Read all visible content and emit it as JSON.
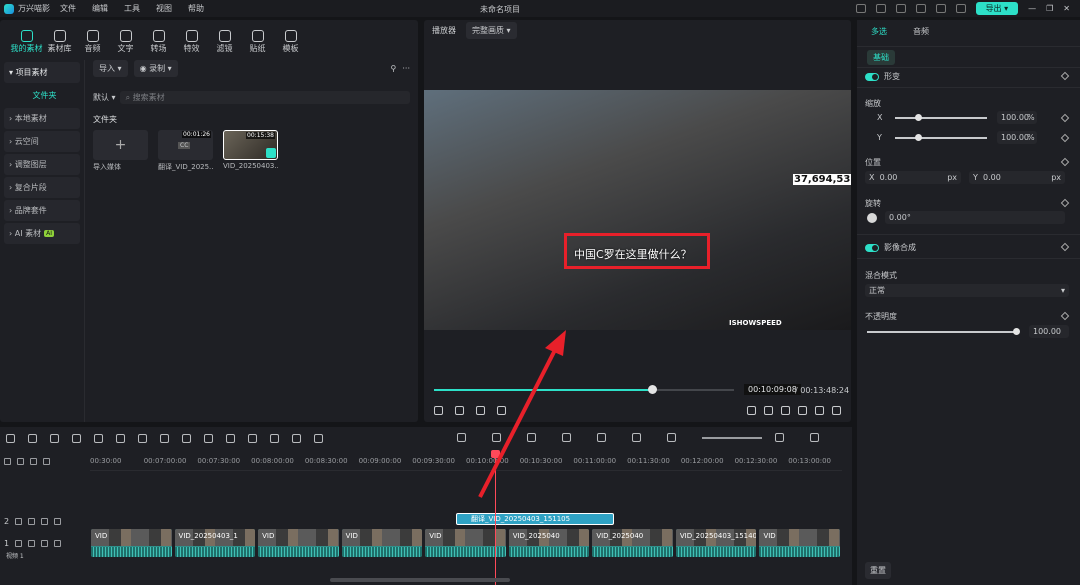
{
  "app": {
    "name": "万兴喵影",
    "project_title": "未命名项目",
    "export_label": "导出"
  },
  "menu": [
    "文件",
    "编辑",
    "工具",
    "视图",
    "帮助"
  ],
  "tools": [
    "我的素材",
    "素材库",
    "音频",
    "文字",
    "转场",
    "特效",
    "滤镜",
    "贴纸",
    "模板"
  ],
  "sidebar": {
    "header": "项目素材",
    "selected": "文件夹",
    "items": [
      "本地素材",
      "云空间",
      "调整图层",
      "复合片段",
      "品牌套件",
      "AI 素材"
    ],
    "ai_badge": "AI"
  },
  "library": {
    "import_label": "导入",
    "record_label": "录制",
    "sort_label": "默认",
    "search_placeholder": "搜索素材",
    "folder_title": "文件夹",
    "items": [
      {
        "label": "导入媒体",
        "duration": ""
      },
      {
        "label": "翻译_VID_2025...",
        "duration": "00:01:26",
        "badge": "CC"
      },
      {
        "label": "VID_20250403...",
        "duration": "00:15:38"
      }
    ]
  },
  "player": {
    "label": "播放器",
    "quality": "完整画质",
    "subtitle": "中国C罗在这里做什么？",
    "counter": "37,694,53",
    "watermark": "ISHOWSPEED",
    "time_current": "00:10:09:08",
    "time_separator": "/",
    "time_total": "00:13:48:24",
    "progress": 0.73
  },
  "properties": {
    "tabs": [
      "多选",
      "音频"
    ],
    "basic_label": "基础",
    "sections": {
      "image": "形变",
      "scale": "缩放",
      "position": "位置",
      "rotate": "旋转",
      "compositing": "影像合成",
      "blend": "混合模式",
      "opacity": "不透明度"
    },
    "scale_x": "100.00",
    "scale_y": "100.00",
    "unit_percent": "%",
    "pos_x": "0.00",
    "pos_y": "0.00",
    "unit_px": "px",
    "axis_x": "X",
    "axis_y": "Y",
    "rotation": "0.00°",
    "blend_mode": "正常",
    "opacity": "100.00",
    "reset_label": "重置"
  },
  "timeline": {
    "ruler": [
      "00:30:00",
      "00:07:00:00",
      "00:07:30:00",
      "00:08:00:00",
      "00:08:30:00",
      "00:09:00:00",
      "00:09:30:00",
      "00:10:00:00",
      "00:10:30:00",
      "00:11:00:00",
      "00:11:30:00",
      "00:12:00:00",
      "00:12:30:00",
      "00:13:00:00"
    ],
    "subtitle_clip": "翻译_VID_20250403_151105",
    "track_labels": {
      "t2": "2",
      "t1": "1",
      "video1": "视频 1"
    },
    "clips": [
      "VID",
      "VID_20250403_1",
      "VID",
      "VID",
      "VID",
      "VID_2025040",
      "VID_2025040",
      "VID_20250403_15140S",
      "VID"
    ]
  }
}
